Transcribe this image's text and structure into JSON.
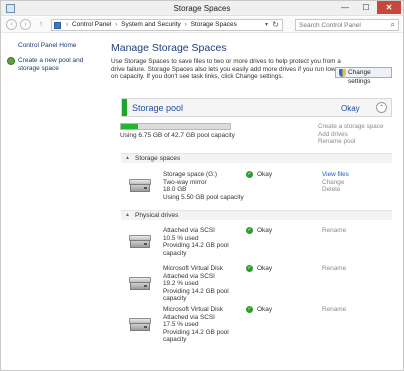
{
  "window": {
    "title": "Storage Spaces",
    "minimize": "—",
    "maximize": "☐",
    "close": "✕"
  },
  "nav": {
    "back": "‹",
    "forward": "›",
    "up": "↑",
    "breadcrumbs": [
      "Control Panel",
      "System and Security",
      "Storage Spaces"
    ],
    "separator": "›",
    "dropdown": "▾",
    "refresh": "↻",
    "search_placeholder": "Search Control Panel",
    "search_icon": "⌕"
  },
  "left_pane": {
    "home": "Control Panel Home",
    "create_pool": "Create a new pool and storage space"
  },
  "main": {
    "title": "Manage Storage Spaces",
    "intro": "Use Storage Spaces to save files to two or more drives to help protect you from a drive failure. Storage Spaces also lets you easily add more drives if you run low on capacity. If you don't see task links, click Change settings.",
    "change_settings": "Change settings"
  },
  "pool": {
    "name": "Storage pool",
    "status": "Okay",
    "collapse": "⌃",
    "usage_text": "Using 6.75 GB of 42.7 GB pool capacity",
    "usage_fraction": 0.158,
    "actions": [
      "Create a storage space",
      "Add drives",
      "Rename pool"
    ]
  },
  "sections": {
    "spaces": "Storage spaces",
    "drives": "Physical drives",
    "triangle": "▲"
  },
  "storage_spaces": [
    {
      "lines": [
        "Storage space (G:)",
        "Two-way mirror",
        "18.0 GB",
        "Using 5.50 GB pool capacity"
      ],
      "status": "Okay",
      "actions": [
        "View files",
        "Change",
        "Delete"
      ]
    }
  ],
  "physical_drives": [
    {
      "lines": [
        "Attached via SCSI",
        "10.5 % used",
        "Providing 14.2 GB pool",
        "capacity"
      ],
      "status": "Okay",
      "action": "Rename"
    },
    {
      "lines": [
        "Microsoft Virtual Disk",
        "Attached via SCSI",
        "19.2 % used",
        "Providing 14.2 GB pool",
        "capacity"
      ],
      "status": "Okay",
      "action": "Rename"
    },
    {
      "lines": [
        "Microsoft Virtual Disk",
        "Attached via SCSI",
        "17.5 % used",
        "Providing 14.2 GB pool",
        "capacity"
      ],
      "status": "Okay",
      "action": "Rename"
    }
  ],
  "colors": {
    "accent_green": "#22a32e",
    "link_blue": "#1e5fb5",
    "title_blue": "#1e3f7c"
  }
}
